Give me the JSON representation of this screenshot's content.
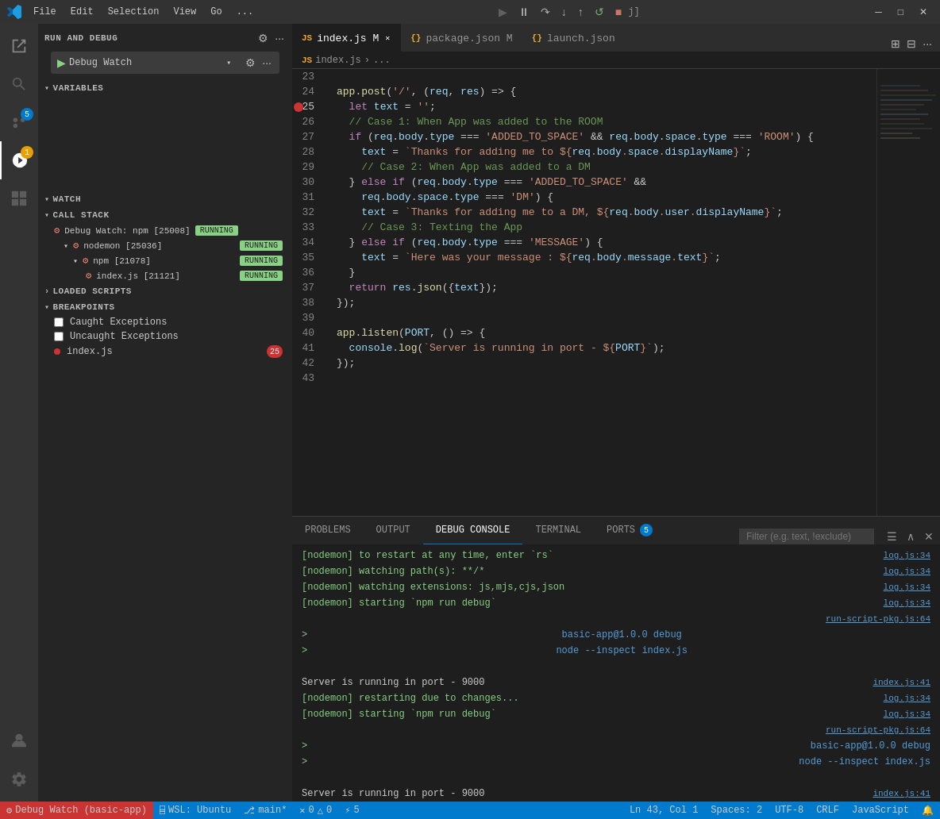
{
  "titlebar": {
    "menus": [
      "File",
      "Edit",
      "Selection",
      "View",
      "Go",
      "..."
    ],
    "debug_actions": [
      "pause",
      "step_over",
      "step_into",
      "step_out",
      "restart",
      "stop"
    ],
    "window_title": "j]",
    "window_controls": [
      "minimize",
      "maximize",
      "close"
    ]
  },
  "sidebar": {
    "run_and_debug_title": "RUN AND DEBUG",
    "debug_config": "Debug Watch",
    "variables_title": "VARIABLES",
    "watch_title": "WATCH",
    "call_stack_title": "CALL STACK",
    "call_stack_items": [
      {
        "name": "Debug Watch: npm [25008]",
        "badge": "RUNNING",
        "type": "main"
      },
      {
        "name": "nodemon [25036]",
        "badge": "RUNNING",
        "type": "sub"
      },
      {
        "name": "npm [21078]",
        "badge": "RUNNING",
        "type": "sub"
      },
      {
        "name": "index.js [21121]",
        "badge": "RUNNING",
        "type": "subsub"
      }
    ],
    "loaded_scripts_title": "LOADED SCRIPTS",
    "breakpoints_title": "BREAKPOINTS",
    "breakpoints": [
      {
        "label": "Caught Exceptions",
        "checked": false
      },
      {
        "label": "Uncaught Exceptions",
        "checked": false
      },
      {
        "label": "index.js",
        "badge": "25",
        "hasRedDot": true
      }
    ]
  },
  "tabs": [
    {
      "name": "index.js",
      "lang_icon": "JS",
      "modified": true,
      "active": true
    },
    {
      "name": "package.json",
      "lang_icon": "{}",
      "modified": true
    },
    {
      "name": "launch.json",
      "lang_icon": "{}",
      "modified": false
    }
  ],
  "breadcrumb": {
    "file": "index.js",
    "path": "..."
  },
  "code": {
    "lines": [
      {
        "num": 23,
        "content": ""
      },
      {
        "num": 24,
        "content": "app.post('/', (req, res) => {",
        "tokens": [
          {
            "t": "method",
            "v": "app.post"
          },
          {
            "t": "punc",
            "v": "("
          },
          {
            "t": "str",
            "v": "'/'"
          },
          {
            "t": "punc",
            "v": ", (req, res) => {"
          }
        ]
      },
      {
        "num": 25,
        "content": "  let text = '';",
        "breakpoint": true
      },
      {
        "num": 26,
        "content": "  // Case 1: When App was added to the ROOM",
        "comment": true
      },
      {
        "num": 27,
        "content": "  if (req.body.type === 'ADDED_TO_SPACE' && req.body.space.type === 'ROOM') {"
      },
      {
        "num": 28,
        "content": "    text = `Thanks for adding me to ${req.body.space.displayName}`;"
      },
      {
        "num": 29,
        "content": "    // Case 2: When App was added to a DM",
        "comment": true
      },
      {
        "num": 30,
        "content": "  } else if (req.body.type === 'ADDED_TO_SPACE' &&"
      },
      {
        "num": 31,
        "content": "    req.body.space.type === 'DM') {"
      },
      {
        "num": 32,
        "content": "    text = `Thanks for adding me to a DM, ${req.body.user.displayName}`;"
      },
      {
        "num": 33,
        "content": "    // Case 3: Texting the App",
        "comment": true
      },
      {
        "num": 34,
        "content": "  } else if (req.body.type === 'MESSAGE') {"
      },
      {
        "num": 35,
        "content": "    text = `Here was your message : ${req.body.message.text}`;"
      },
      {
        "num": 36,
        "content": "  }"
      },
      {
        "num": 37,
        "content": "  return res.json({text});"
      },
      {
        "num": 38,
        "content": "});"
      },
      {
        "num": 39,
        "content": ""
      },
      {
        "num": 40,
        "content": "app.listen(PORT, () => {"
      },
      {
        "num": 41,
        "content": "  console.log(`Server is running in port - ${PORT}`);"
      },
      {
        "num": 42,
        "content": "});"
      },
      {
        "num": 43,
        "content": ""
      }
    ]
  },
  "panel": {
    "tabs": [
      "PROBLEMS",
      "OUTPUT",
      "DEBUG CONSOLE",
      "TERMINAL",
      "PORTS"
    ],
    "active_tab": "DEBUG CONSOLE",
    "ports_badge": "5",
    "filter_placeholder": "Filter (e.g. text, !exclude)",
    "console_lines": [
      {
        "text": "[nodemon] to restart at any time, enter `rs`",
        "source": "log.js:34",
        "type": "nodemon"
      },
      {
        "text": "[nodemon] watching path(s): **/*",
        "source": "log.js:34",
        "type": "nodemon"
      },
      {
        "text": "[nodemon] watching extensions: js,mjs,cjs,json",
        "source": "log.js:34",
        "type": "nodemon"
      },
      {
        "text": "[nodemon] starting `npm run debug`",
        "source": "log.js:34",
        "type": "nodemon"
      },
      {
        "text": "",
        "source": "run-script-pkg.js:64",
        "type": "plain"
      },
      {
        "text": "> basic-app@1.0.0 debug",
        "source": "",
        "type": "cmd"
      },
      {
        "text": "> node --inspect index.js",
        "source": "",
        "type": "cmd"
      },
      {
        "text": "",
        "source": "",
        "type": "plain"
      },
      {
        "text": "Server is running in port - 9000",
        "source": "index.js:41",
        "type": "server"
      },
      {
        "text": "[nodemon] restarting due to changes...",
        "source": "log.js:34",
        "type": "nodemon"
      },
      {
        "text": "[nodemon] starting `npm run debug`",
        "source": "log.js:34",
        "type": "nodemon"
      },
      {
        "text": "",
        "source": "run-script-pkg.js:64",
        "type": "plain"
      },
      {
        "text": "> basic-app@1.0.0 debug",
        "source": "",
        "type": "cmd"
      },
      {
        "text": "> node --inspect index.js",
        "source": "",
        "type": "cmd"
      },
      {
        "text": "",
        "source": "",
        "type": "plain"
      },
      {
        "text": "Server is running in port - 9000",
        "source": "index.js:41",
        "type": "server"
      }
    ]
  },
  "statusbar": {
    "wsl": "WSL: Ubuntu",
    "git_branch": "main*",
    "errors": "0",
    "warnings": "0",
    "debug_watch": "Debug Watch (basic-app)",
    "cursor": "Ln 43, Col 1",
    "spaces": "Spaces: 2",
    "encoding": "UTF-8",
    "line_ending": "CRLF",
    "language": "JavaScript"
  }
}
